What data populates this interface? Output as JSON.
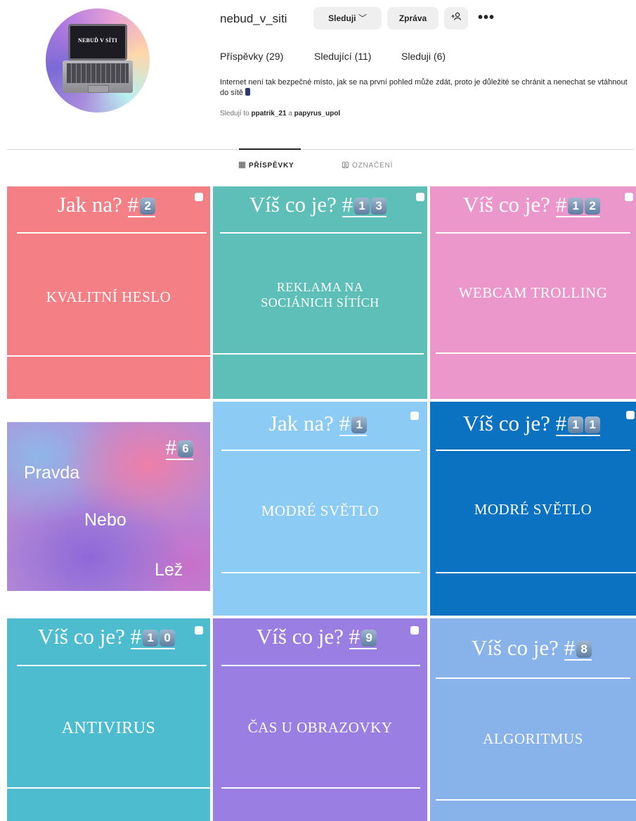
{
  "profile": {
    "avatar_text": "NEBUĎ V SÍTI",
    "username": "nebud_v_siti",
    "follow_button": "Sleduji",
    "message_button": "Zpráva",
    "add_person_icon": "+ꕤ",
    "more_icon": "•••",
    "stats": {
      "posts": "Příspěvky (29)",
      "followers": "Sledující (11)",
      "following": "Sleduji (6)"
    },
    "bio": "Internet není tak bezpečné místo, jak se na první pohled může zdát, proto je důležité se chránit a nenechat se vtáhnout do sítě",
    "followed_by_prefix": "Sledují to",
    "followed_by_user1": "ppatrik_21",
    "followed_by_and": "a",
    "followed_by_user2": "papyrus_upol"
  },
  "tabs": {
    "posts": "PŘÍSPĚVKY",
    "tagged": "OZNAČENÍ"
  },
  "posts": [
    {
      "title": "Jak na?",
      "hash": "#",
      "num": [
        "2"
      ],
      "label": "KVALITNÍ HESLO",
      "color": "#f47f85"
    },
    {
      "title": "Víš co je?",
      "hash": "#",
      "num": [
        "1",
        "3"
      ],
      "label": "REKLAMA NA SOCIÁNICH SÍTÍCH",
      "color": "#5dbfb7"
    },
    {
      "title": "Víš co je?",
      "hash": "#",
      "num": [
        "1",
        "2"
      ],
      "label": "WEBCAM TROLLING",
      "color": "#ec97cc"
    },
    {
      "hash": "#",
      "num": [
        "6"
      ],
      "words": [
        "Pravda",
        "Nebo",
        "Lež"
      ]
    },
    {
      "title": "Jak na?",
      "hash": "#",
      "num": [
        "1"
      ],
      "label": "MODRÉ SVĚTLO",
      "color": "#8ccbf4"
    },
    {
      "title": "Víš co je?",
      "hash": "#",
      "num": [
        "1",
        "1"
      ],
      "label": "MODRÉ SVĚTLO",
      "color": "#0a72c0"
    },
    {
      "title": "Víš co je?",
      "hash": "#",
      "num": [
        "1",
        "0"
      ],
      "label": "ANTIVIRUS",
      "color": "#4ebccf"
    },
    {
      "title": "Víš co je?",
      "hash": "#",
      "num": [
        "9"
      ],
      "label": "ČAS U OBRAZOVKY",
      "color": "#9a7ee2"
    },
    {
      "title": "Víš co je?",
      "hash": "#",
      "num": [
        "8"
      ],
      "label": "ALGORITMUS",
      "color": "#88b2ea"
    }
  ]
}
